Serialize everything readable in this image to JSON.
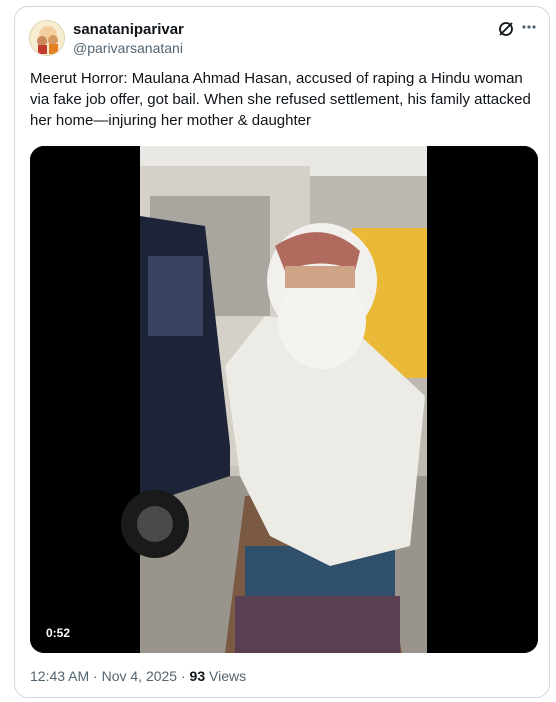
{
  "author": {
    "display_name": "sanataniparivar",
    "handle": "@parivarsanatani"
  },
  "tweet": {
    "text": "Meerut Horror: Maulana Ahmad Hasan, accused of raping a Hindu woman via fake job offer, got bail. When she refused settlement, his family attacked her home—injuring her mother & daughter"
  },
  "video": {
    "duration": "0:52"
  },
  "meta": {
    "time_date": "12:43 AM · Nov 4, 2025",
    "separator": " · ",
    "views_count": "93",
    "views_label": "Views"
  },
  "icons": {
    "grok": "grok-icon",
    "more": "more-options-icon"
  },
  "colors": {
    "text_primary": "#0f1419",
    "text_secondary": "#536471",
    "border": "#cfd9de"
  }
}
